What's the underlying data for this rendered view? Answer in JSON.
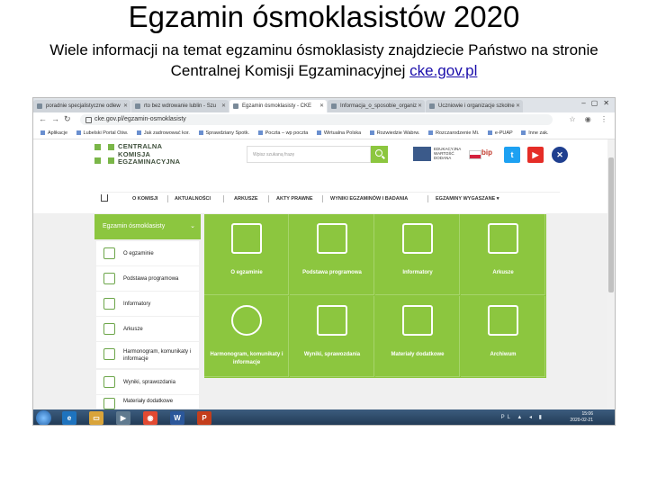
{
  "slide": {
    "title": "Egzamin ósmoklasistów 2020",
    "subtitle": "Wiele informacji na temat egzaminu ósmoklasisty znajdziecie Państwo na stronie Centralnej Komisji Egzaminacyjnej",
    "link": "cke.gov.pl"
  },
  "browser": {
    "tabs": [
      {
        "label": "poradnie specjalistyczne odlew"
      },
      {
        "label": "rto bez wdrowanie lublin - Szu"
      },
      {
        "label": "Egzamin ósmoklasisty - CKE"
      },
      {
        "label": "Informacja_o_sposobie_organiz"
      },
      {
        "label": "Uczniowie i organizacje szkolne"
      }
    ],
    "url": "cke.gov.pl/egzamin-osmoklasisty",
    "bookmarks": [
      "Aplikacje",
      "Lubelski Portal Ośw.",
      "Jak zadrowować kor.",
      "Sprawdziany Spotk.",
      "Poczta – wp poczta",
      "Wirtualna Polska",
      "Rozwiedzie Wabrw.",
      "Rozczarodzenie Mi.",
      "e-PUAP",
      "Inne zak."
    ]
  },
  "site": {
    "logo_lines": [
      "CENTRALNA",
      "KOMISJA",
      "EGZAMINACYJNA"
    ],
    "search_placeholder": "Wpisz szukaną frazę",
    "partner_text": "EDUKACYJNA WARTOŚĆ DODANA",
    "bip": "bip",
    "menu": [
      "O KOMISJI",
      "AKTUALNOŚCI",
      "ARKUSZE",
      "AKTY PRAWNE",
      "WYNIKI EGZAMINÓW I BADANIA",
      "EGZAMINY WYGASZANE ▾"
    ],
    "sidebar_title": "Egzamin ósmoklasisty",
    "sidebar_items": [
      {
        "label": "O egzaminie"
      },
      {
        "label": "Podstawa programowa"
      },
      {
        "label": "Informatory"
      },
      {
        "label": "Arkusze"
      },
      {
        "label": "Harmonogram, komunikaty i informacje"
      },
      {
        "label": "Wyniki, sprawozdania"
      },
      {
        "label": "Materiały dodatkowe"
      }
    ],
    "tiles": [
      {
        "label": "O egzaminie"
      },
      {
        "label": "Podstawa programowa"
      },
      {
        "label": "Informatory"
      },
      {
        "label": "Arkusze"
      },
      {
        "label": "Harmonogram, komunikaty i informacje"
      },
      {
        "label": "Wyniki, sprawozdania"
      },
      {
        "label": "Materiały dodatkowe"
      },
      {
        "label": "Archiwum"
      }
    ]
  },
  "taskbar": {
    "time": "15:06",
    "date": "2020-02-21",
    "lang": "PL"
  }
}
